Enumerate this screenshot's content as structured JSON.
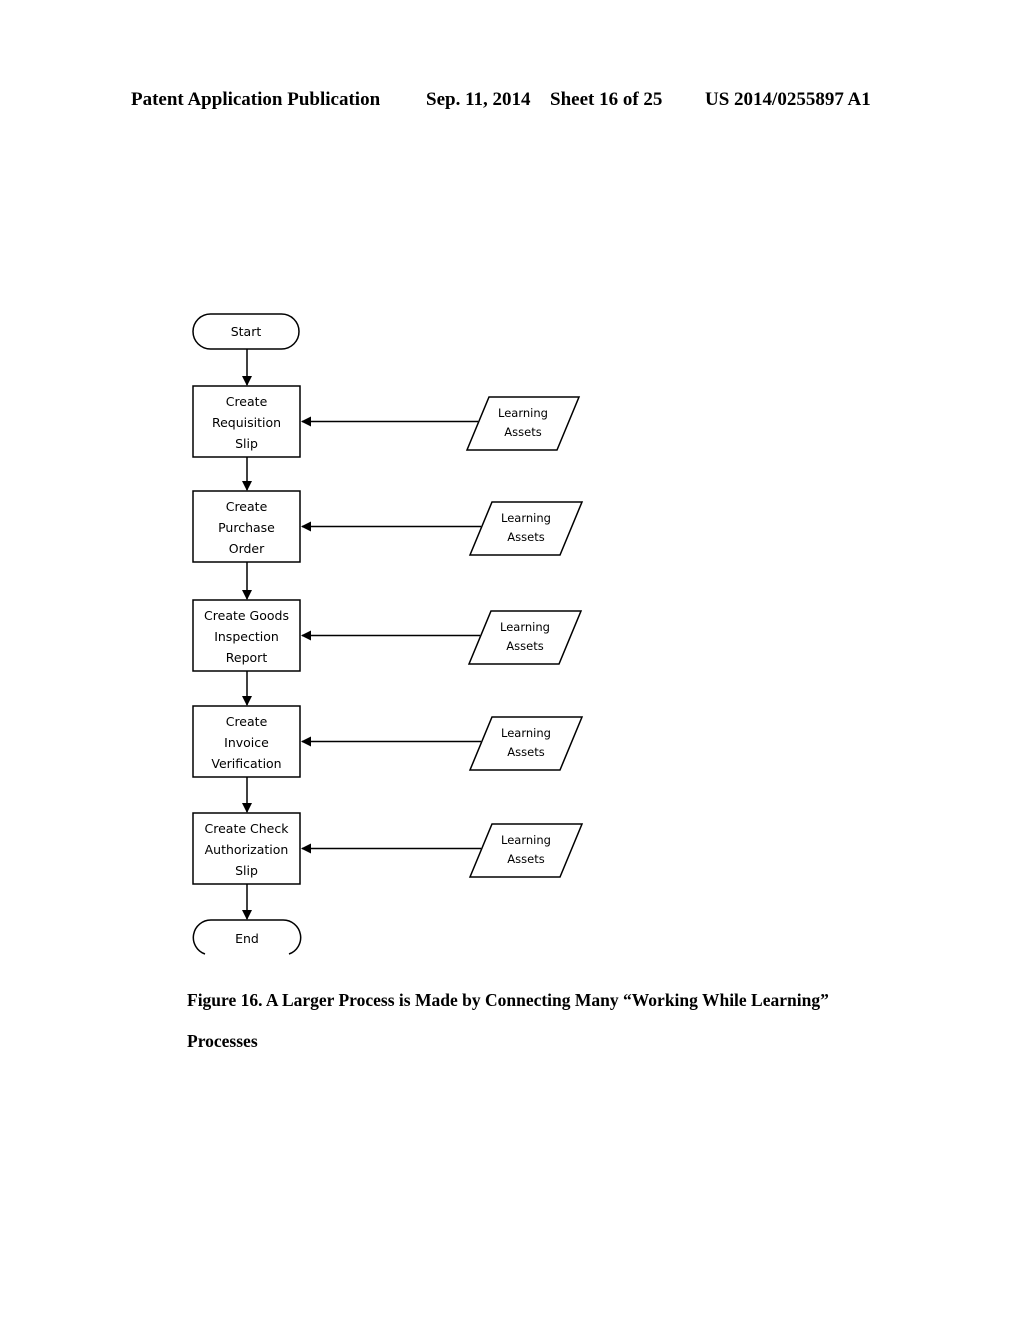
{
  "header": {
    "publication": "Patent Application Publication",
    "date": "Sep. 11, 2014",
    "sheet": "Sheet 16 of 25",
    "number": "US 2014/0255897 A1"
  },
  "flow": {
    "start": "Start",
    "end": "End",
    "steps": [
      {
        "lines": [
          "Create",
          "Requisition",
          "Slip"
        ],
        "input": [
          "Learning",
          "Assets"
        ]
      },
      {
        "lines": [
          "Create",
          "Purchase",
          "Order"
        ],
        "input": [
          "Learning",
          "Assets"
        ]
      },
      {
        "lines": [
          "Create Goods",
          "Inspection",
          "Report"
        ],
        "input": [
          "Learning",
          "Assets"
        ]
      },
      {
        "lines": [
          "Create",
          "Invoice",
          "Verification"
        ],
        "input": [
          "Learning",
          "Assets"
        ]
      },
      {
        "lines": [
          "Create Check",
          "Authorization",
          "Slip"
        ],
        "input": [
          "Learning",
          "Assets"
        ]
      }
    ]
  },
  "caption": {
    "line1": "Figure 16.  A Larger Process is Made by Connecting Many “Working While Learning”",
    "line2": "Processes"
  }
}
